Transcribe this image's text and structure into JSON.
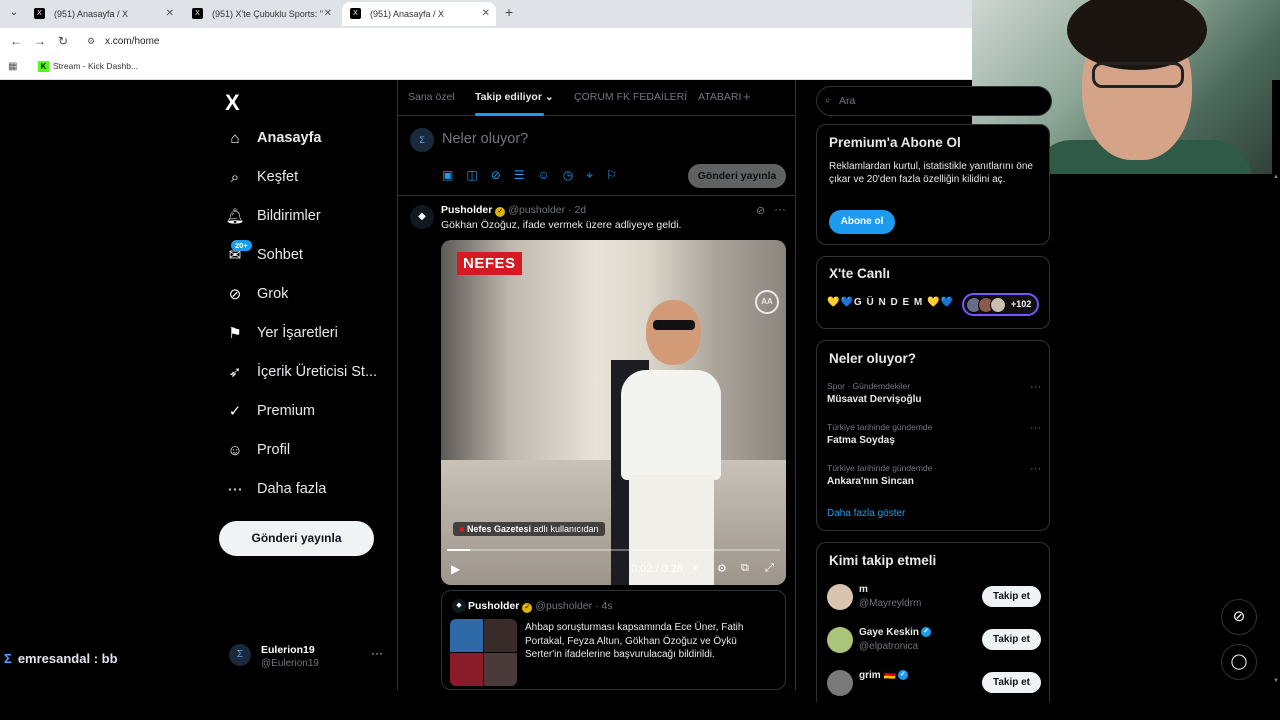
{
  "browser": {
    "tabs": [
      {
        "title": "(951) Anasayfa / X",
        "favicon": "X"
      },
      {
        "title": "(951) X'te Çubuklu Sports: \"",
        "favicon": "X"
      },
      {
        "title": "(951) Anasayfa / X",
        "favicon": "X"
      }
    ],
    "url": "x.com/home",
    "bookmark": "Stream - Kick Dashb..."
  },
  "sidebar": {
    "logo": "X",
    "items": [
      {
        "label": "Anasayfa",
        "icon": "home-icon",
        "glyph": "⌂"
      },
      {
        "label": "Keşfet",
        "icon": "search-icon",
        "glyph": "⌕"
      },
      {
        "label": "Bildirimler",
        "icon": "bell-icon",
        "glyph": "🔔︎"
      },
      {
        "label": "Sohbet",
        "icon": "chat-icon",
        "glyph": "✉"
      },
      {
        "label": "Grok",
        "icon": "grok-icon",
        "glyph": "⊘"
      },
      {
        "label": "Yer İşaretleri",
        "icon": "bookmark-icon",
        "glyph": "⚑"
      },
      {
        "label": "İçerik Üreticisi St...",
        "icon": "rocket-icon",
        "glyph": "➶"
      },
      {
        "label": "Premium",
        "icon": "verified-icon",
        "glyph": "✓"
      },
      {
        "label": "Profil",
        "icon": "person-icon",
        "glyph": "☺"
      },
      {
        "label": "Daha fazla",
        "icon": "more-circle-icon",
        "glyph": "⋯"
      }
    ],
    "chat_badge": "20+",
    "post_button": "Gönderi yayınla",
    "user": {
      "name": "Eulerion19",
      "handle": "@Eulerion19"
    }
  },
  "stream_chat": {
    "user": "emresandal",
    "sep": " : ",
    "message": "bb"
  },
  "feed": {
    "tabs": [
      "Sana özel",
      "Takip ediliyor",
      "ÇORUM FK FEDAİLERİ",
      "ATABARI"
    ],
    "compose_placeholder": "Neler oluyor?",
    "compose_post": "Gönderi yayınla",
    "tweet": {
      "name": "Pusholder",
      "handle": "@pusholder",
      "time": "· 2d",
      "text": "Gökhan Özoğuz, ifade vermek üzere adliyeye geldi.",
      "video": {
        "brand": "NEFES",
        "agency": "AA",
        "credit_bold": "Nefes Gazetesi",
        "credit_rest": "adlı kullanıcıdan",
        "time": "0:02 / 0:28",
        "progress": 0.07
      },
      "quote": {
        "name": "Pusholder",
        "handle": "@pusholder",
        "time": "· 4s",
        "text": "Ahbap soruşturması kapsamında Ece Üner, Fatih Portakal, Feyza Altun, Gökhan Özoğuz ve Öykü Serter'in ifadelerine başvurulacağı bildirildi."
      }
    }
  },
  "right": {
    "search_placeholder": "Ara",
    "premium": {
      "title": "Premium'a Abone Ol",
      "desc": "Reklamlardan kurtul, istatistikle yanıtlarını öne çıkar ve 20'den fazla özelliğin kilidini aç.",
      "button": "Abone ol"
    },
    "live": {
      "title": "X'te Canlı",
      "space": "💛💙G Ü N D E M 💛💙",
      "count": "+102"
    },
    "trends": {
      "title": "Neler oluyor?",
      "items": [
        {
          "context": "Spor · Gündemdekiler",
          "topic": "Müsavat Dervişoğlu"
        },
        {
          "context": "Türkiye tarihinde gündemde",
          "topic": "Fatma Soydaş"
        },
        {
          "context": "Türkiye tarihinde gündemde",
          "topic": "Ankara'nın Sincan"
        }
      ],
      "more": "Daha fazla göster"
    },
    "who_to_follow": {
      "title": "Kimi takip etmeli",
      "items": [
        {
          "name": "m",
          "handle": "@Mayreyldrm",
          "verified": false,
          "button": "Takip et"
        },
        {
          "name": "Gaye Keskin",
          "handle": "@elpatronica",
          "verified": true,
          "button": "Takip et"
        },
        {
          "name": "grim 🇩🇪",
          "handle": "",
          "verified": true,
          "button": "Takip et"
        }
      ]
    }
  },
  "colors": {
    "accent": "#1d9bf0",
    "gold": "#e0b400",
    "border": "#2f3336",
    "muted": "#71767b"
  }
}
